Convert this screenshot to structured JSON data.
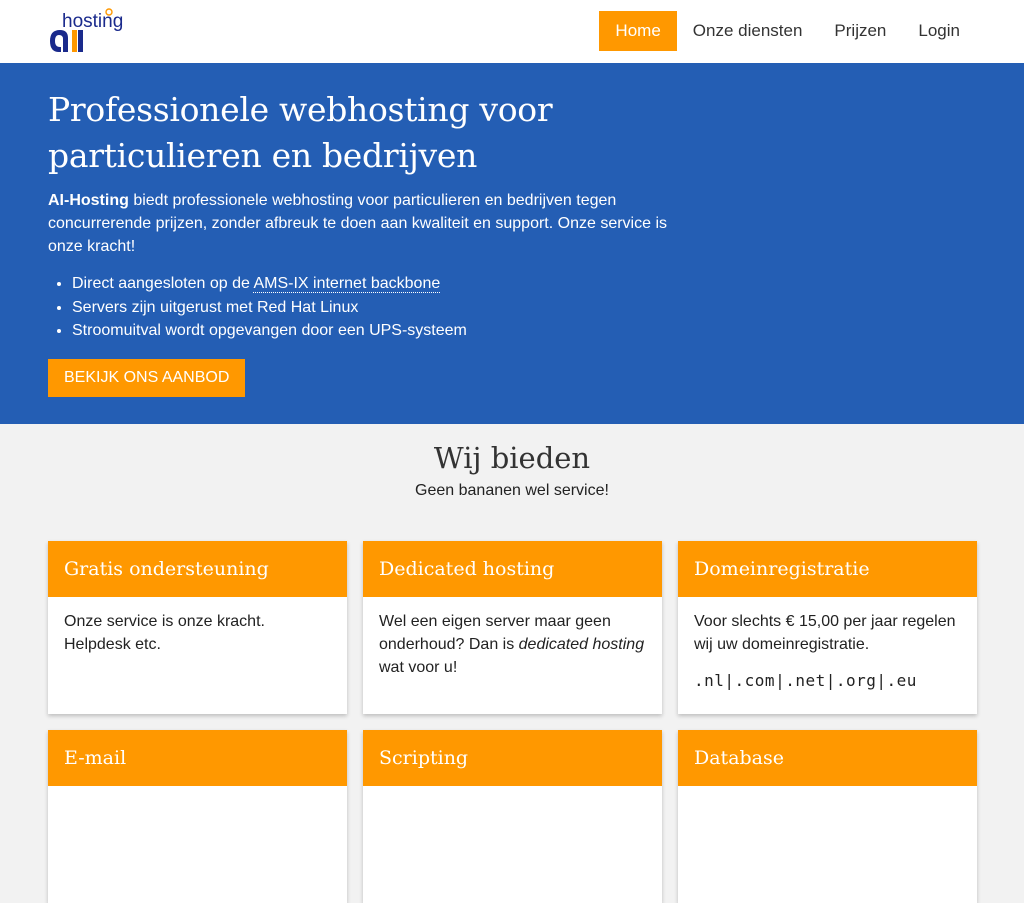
{
  "brand": {
    "logo_text_top": "hosting",
    "logo_text_bottom": "ai"
  },
  "nav": {
    "items": [
      {
        "label": "Home",
        "active": true
      },
      {
        "label": "Onze diensten",
        "active": false
      },
      {
        "label": "Prijzen",
        "active": false
      },
      {
        "label": "Login",
        "active": false
      }
    ]
  },
  "hero": {
    "title": "Professionele webhosting voor particulieren en bedrijven",
    "intro_bold": "AI-Hosting",
    "intro_rest": " biedt professionele webhosting voor particulieren en bedrijven tegen concurrerende prijzen, zonder afbreuk te doen aan kwaliteit en support. Onze service is onze kracht!",
    "bullets": {
      "b1_prefix": "Direct aangesloten op de ",
      "b1_link": "AMS-IX internet backbone",
      "b2": "Servers zijn uitgerust met Red Hat Linux",
      "b3": "Stroomuitval wordt opgevangen door een UPS-systeem"
    },
    "cta_label": "BEKIJK ONS AANBOD"
  },
  "offer": {
    "title": "Wij bieden",
    "subtitle": "Geen bananen wel service!",
    "cards": [
      {
        "title": "Gratis ondersteuning",
        "text": "Onze service is onze kracht. Helpdesk etc."
      },
      {
        "title": "Dedicated hosting",
        "text_pre": "Wel een eigen server maar geen onderhoud? Dan is ",
        "text_em": "dedicated hosting",
        "text_post": " wat voor u!"
      },
      {
        "title": "Domeinregistratie",
        "text": "Voor slechts € 15,00 per jaar regelen wij uw domeinregistratie.",
        "tlds": ".nl|.com|.net|.org|.eu"
      },
      {
        "title": "E-mail"
      },
      {
        "title": "Scripting"
      },
      {
        "title": "Database"
      }
    ]
  },
  "colors": {
    "accent": "#ff9800",
    "hero_bg": "#245eb4",
    "page_bg": "#f2f2f2"
  }
}
